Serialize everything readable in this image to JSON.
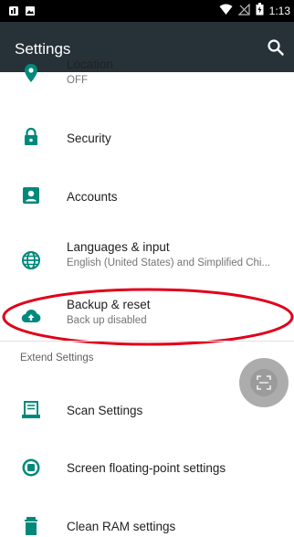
{
  "status_bar": {
    "time": "1:13",
    "icons": [
      "sim-notification-icon",
      "image-notification-icon",
      "wifi-icon",
      "no-signal-icon",
      "battery-icon"
    ]
  },
  "app_bar": {
    "title": "Settings",
    "search_icon": "search-icon"
  },
  "items": [
    {
      "title": "Location",
      "subtitle": "OFF",
      "icon": "location-pin-icon"
    },
    {
      "title": "Security",
      "icon": "lock-icon"
    },
    {
      "title": "Accounts",
      "icon": "account-box-icon"
    },
    {
      "title": "Languages & input",
      "subtitle": "English (United States) and Simplified Chi...",
      "icon": "globe-icon"
    },
    {
      "title": "Backup & reset",
      "subtitle": "Back up disabled",
      "icon": "cloud-upload-icon"
    }
  ],
  "extend_section": {
    "header": "Extend Settings",
    "items": [
      {
        "title": "Scan Settings",
        "icon": "scanner-icon"
      },
      {
        "title": "Screen floating-point settings",
        "icon": "radio-dot-icon"
      },
      {
        "title": "Clean RAM settings",
        "icon": "trash-icon"
      }
    ]
  },
  "colors": {
    "accent": "#00897b",
    "app_bar": "#263238",
    "status_bar": "#000000",
    "annotation": "#e0001b"
  }
}
